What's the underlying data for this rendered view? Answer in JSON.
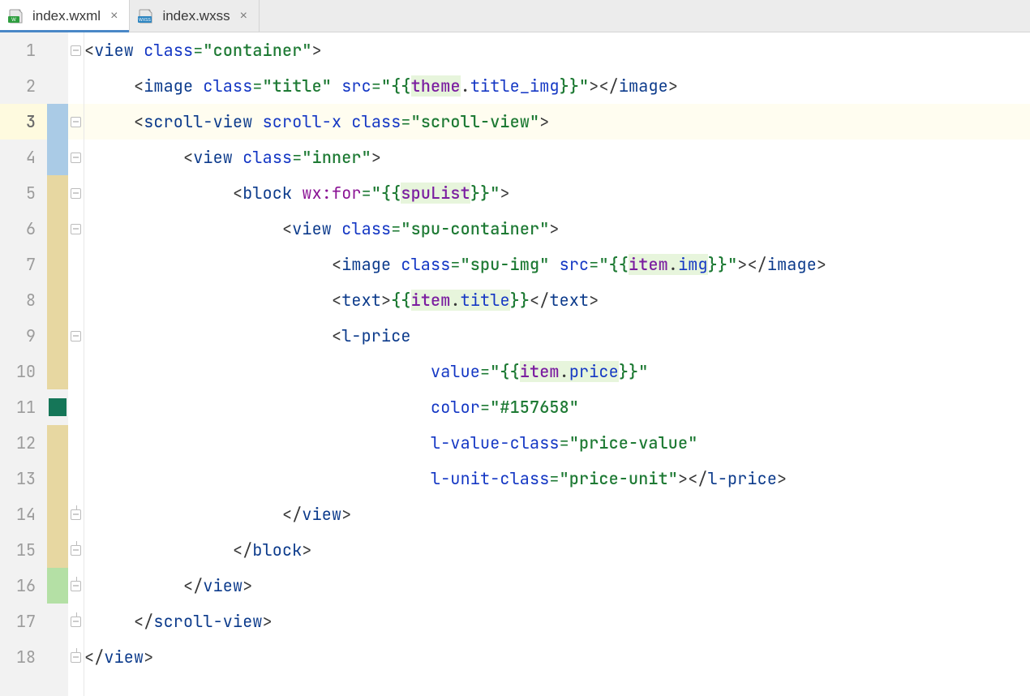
{
  "tabs": [
    {
      "label": "index.wxml",
      "icon": "wxml",
      "active": true
    },
    {
      "label": "index.wxss",
      "icon": "wxss",
      "active": false
    }
  ],
  "lineNumbers": [
    "1",
    "2",
    "3",
    "4",
    "5",
    "6",
    "7",
    "8",
    "9",
    "10",
    "11",
    "12",
    "13",
    "14",
    "15",
    "16",
    "17",
    "18"
  ],
  "currentLine": 3,
  "code": {
    "l1": {
      "open": "<",
      "tag": "view",
      "a1": "class",
      "v1": "\"container\"",
      "close": ">"
    },
    "l2": {
      "open": "<",
      "tag": "image",
      "a1": "class",
      "v1": "\"title\"",
      "a2": "src",
      "v2p": "\"{{",
      "e2a": "theme",
      "dot": ".",
      "e2b": "title_img",
      "v2s": "}}\"",
      "close1": ">",
      "openc": "</",
      "tagc": "image",
      "close2": ">"
    },
    "l3": {
      "open": "<",
      "tag": "scroll-view",
      "a1": "scroll-x",
      "a2": "class",
      "v2": "\"scroll-view\"",
      "close": ">"
    },
    "l4": {
      "open": "<",
      "tag": "view",
      "a1": "class",
      "v1": "\"inner\"",
      "close": ">"
    },
    "l5": {
      "open": "<",
      "tag": "block",
      "a1": "wx:for",
      "v1p": "\"{{",
      "e1": "spuList",
      "v1s": "}}\"",
      "close": ">"
    },
    "l6": {
      "open": "<",
      "tag": "view",
      "a1": "class",
      "v1": "\"spu-container\"",
      "close": ">"
    },
    "l7": {
      "open": "<",
      "tag": "image",
      "a1": "class",
      "v1": "\"spu-img\"",
      "a2": "src",
      "v2p": "\"{{",
      "e2a": "item",
      "dot": ".",
      "e2b": "img",
      "v2s": "}}\"",
      "close1": ">",
      "openc": "</",
      "tagc": "image",
      "close2": ">"
    },
    "l8": {
      "open": "<",
      "tag": "text",
      "close1": ">",
      "tp": "{{",
      "ea": "item",
      "dot": ".",
      "eb": "title",
      "ts": "}}",
      "openc": "</",
      "tagc": "text",
      "close2": ">"
    },
    "l9": {
      "open": "<",
      "tag": "l-price"
    },
    "l10": {
      "a": "value",
      "vp": "\"{{",
      "ea": "item",
      "dot": ".",
      "eb": "price",
      "vs": "}}\""
    },
    "l11": {
      "a": "color",
      "v": "\"#157658\""
    },
    "l12": {
      "a": "l-value-class",
      "v": "\"price-value\""
    },
    "l13": {
      "a": "l-unit-class",
      "v": "\"price-unit\"",
      "close1": ">",
      "openc": "</",
      "tagc": "l-price",
      "close2": ">"
    },
    "l14": {
      "open": "</",
      "tag": "view",
      "close": ">"
    },
    "l15": {
      "open": "</",
      "tag": "block",
      "close": ">"
    },
    "l16": {
      "open": "</",
      "tag": "view",
      "close": ">"
    },
    "l17": {
      "open": "</",
      "tag": "scroll-view",
      "close": ">"
    },
    "l18": {
      "open": "</",
      "tag": "view",
      "close": ">"
    }
  },
  "markers": [
    "neutral",
    "neutral",
    "blue",
    "blue",
    "tan",
    "tan",
    "tan",
    "tan",
    "tan",
    "tan",
    "greenD",
    "tan",
    "tan",
    "tan",
    "tan",
    "greenL",
    "neutral",
    "neutral"
  ],
  "folds": [
    "open",
    "none",
    "open",
    "open",
    "open",
    "open",
    "none",
    "none",
    "open",
    "none",
    "none",
    "none",
    "none",
    "end",
    "end",
    "end",
    "end",
    "end"
  ]
}
